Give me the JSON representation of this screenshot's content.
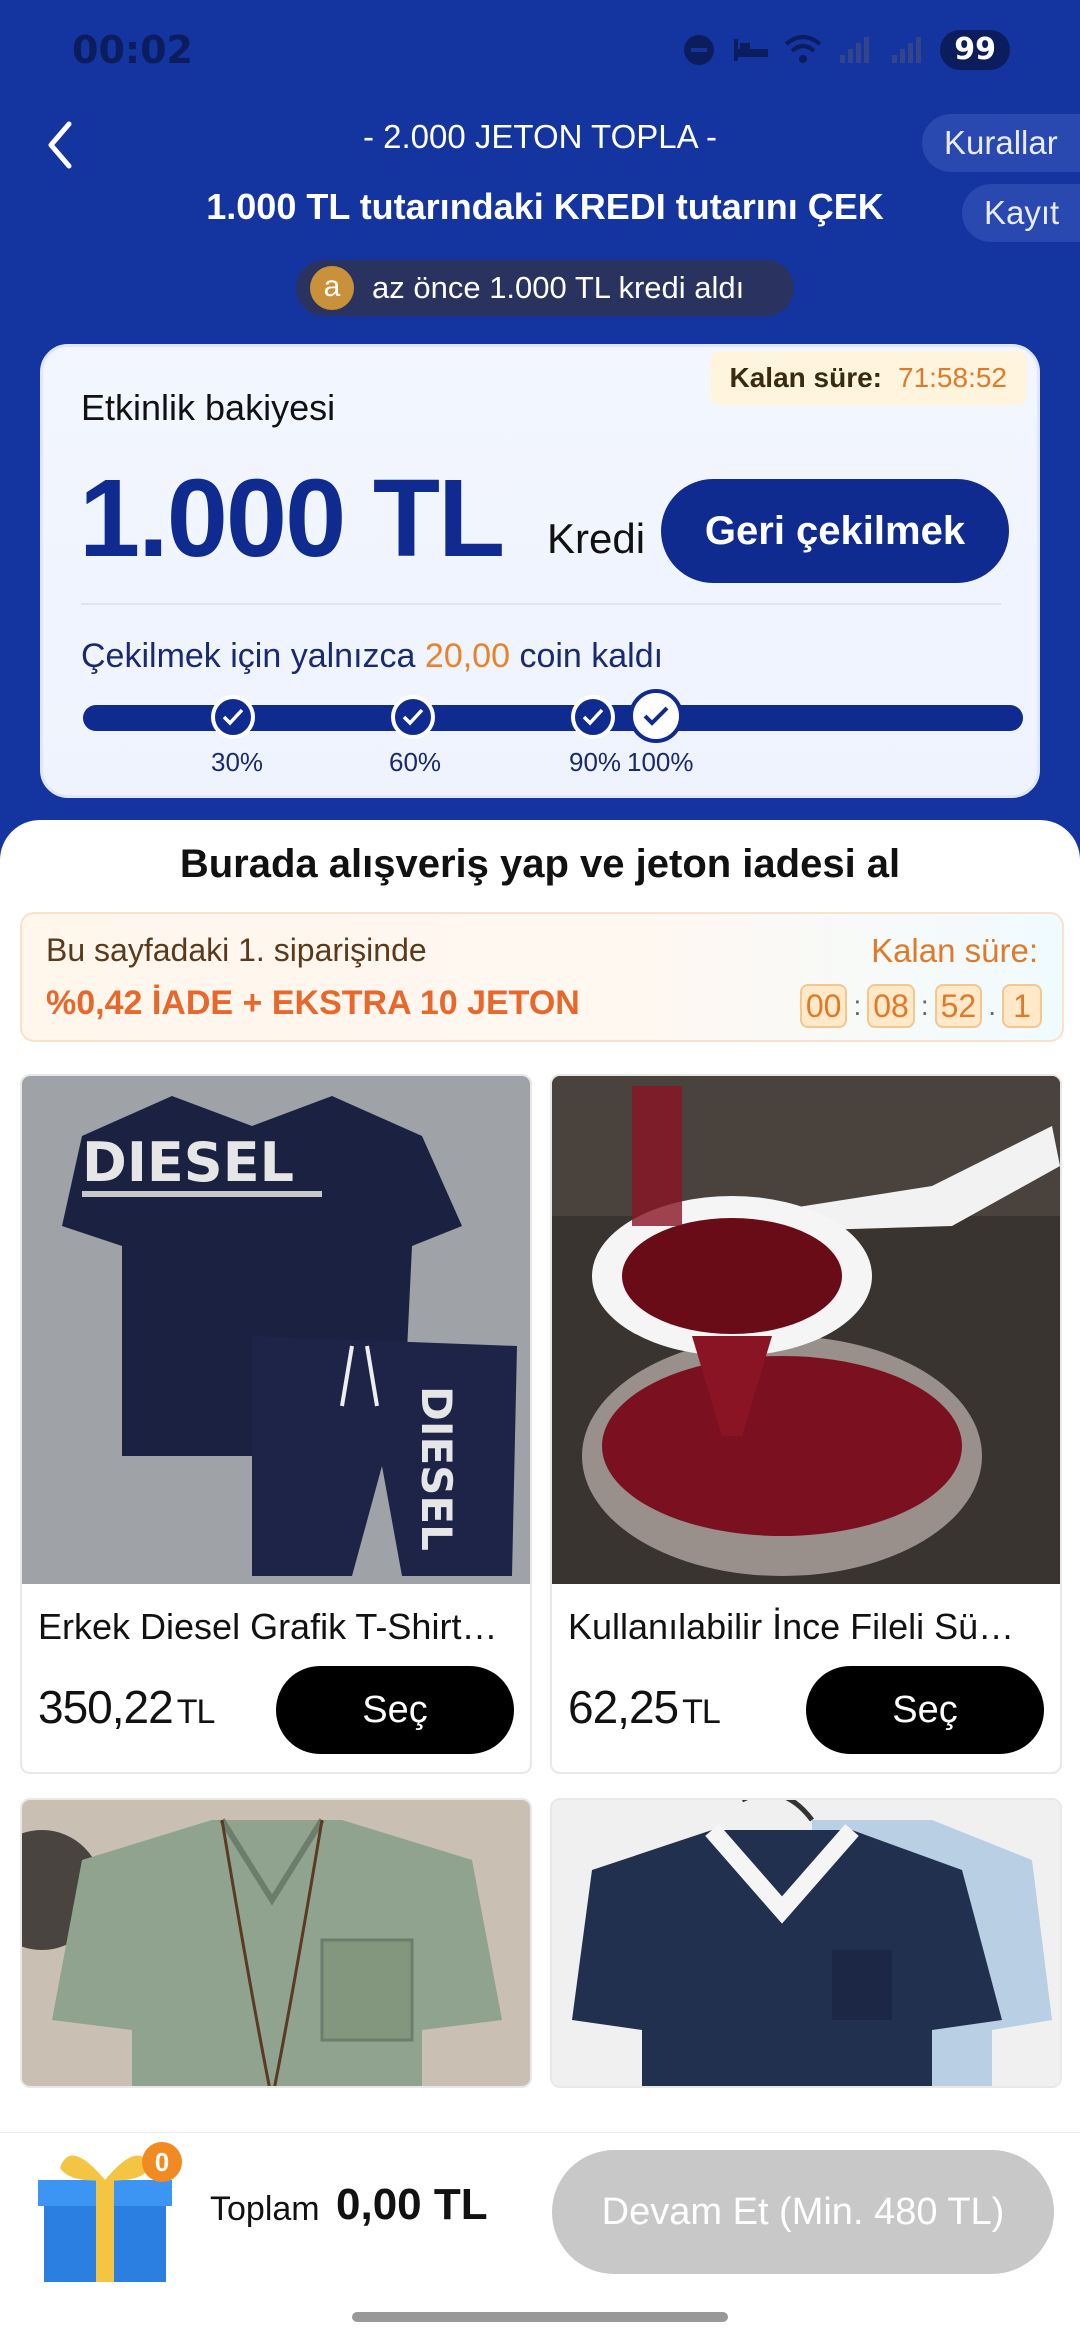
{
  "status_bar": {
    "time": "00:02",
    "battery": "99"
  },
  "header": {
    "title_line1": "- 2.000 JETON TOPLA -",
    "title_line2": "1.000 TL tutarındaki KREDI tutarını ÇEK",
    "rules_label": "Kurallar",
    "log_label": "Kayıt",
    "ticker_avatar": "a",
    "ticker_text": "az önce 1.000 TL kredi aldı"
  },
  "balance_card": {
    "remaining_label": "Kalan süre:",
    "remaining_value": "71:58:52",
    "label": "Etkinlik bakiyesi",
    "amount": "1.000 TL",
    "unit": "Kredi",
    "withdraw_label": "Geri çekilmek",
    "progress_prefix": "Çekilmek için yalnızca",
    "progress_amount": "20,00",
    "progress_suffix": "coin kaldı",
    "progress_fraction": 1.0,
    "milestones": [
      "30%",
      "60%",
      "90%",
      "100%"
    ]
  },
  "section": {
    "title": "Burada alışveriş yap ve jeton iadesi al"
  },
  "promo": {
    "line1": "Bu sayfadaki 1. siparişinde",
    "refund": "%0,42 İADE",
    "plus": "+",
    "extra": "EKSTRA 10 JETON",
    "timer_label": "Kalan süre:",
    "timer": [
      "00",
      "08",
      "52",
      "1"
    ]
  },
  "products": [
    {
      "name": "Erkek Diesel Grafik T-Shirt…",
      "price": "350,22",
      "currency": "TL",
      "button": "Seç",
      "image": "diesel-shirt-shorts-set"
    },
    {
      "name": "Kullanılabilir İnce Fileli Sü…",
      "price": "62,25",
      "currency": "TL",
      "button": "Seç",
      "image": "mesh-strainer"
    },
    {
      "name": "",
      "price": "",
      "currency": "",
      "button": "",
      "image": "green-linen-shirt"
    },
    {
      "name": "",
      "price": "",
      "currency": "",
      "button": "",
      "image": "navy-shirt"
    }
  ],
  "bottom": {
    "gift_count": "0",
    "total_label": "Toplam",
    "total_value": "0,00 TL",
    "continue_label": "Devam Et (Min. 480 TL)"
  },
  "colors": {
    "brand": "#1434a0",
    "accent": "#e8832c",
    "button_dark": "#000000"
  }
}
